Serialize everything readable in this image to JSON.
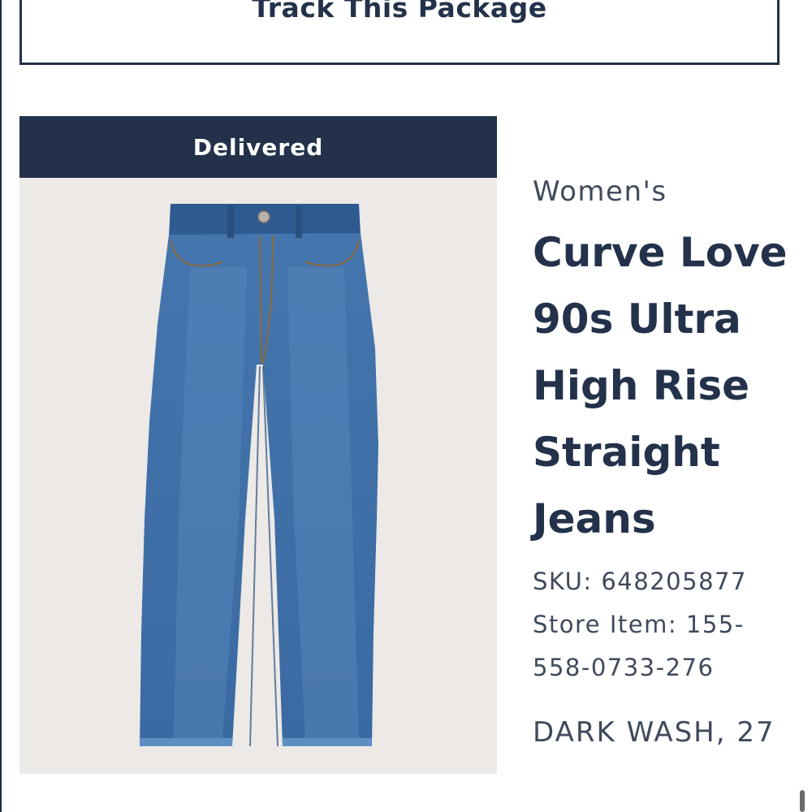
{
  "track_button": {
    "label": "Track This Package"
  },
  "order_item": {
    "status": "Delivered",
    "product_image": {
      "alt": "Blue denim straight jeans"
    },
    "category": "Women's",
    "title": "Curve Love 90s Ultra High Rise Straight Jeans",
    "sku": "SKU: 648205877",
    "store_item": "Store Item: 155-558-0733-276",
    "variant": "DARK WASH, 27"
  },
  "colors": {
    "navy": "#23324a",
    "image_background": "#ece9e7",
    "denim": "#3c6aa3"
  }
}
